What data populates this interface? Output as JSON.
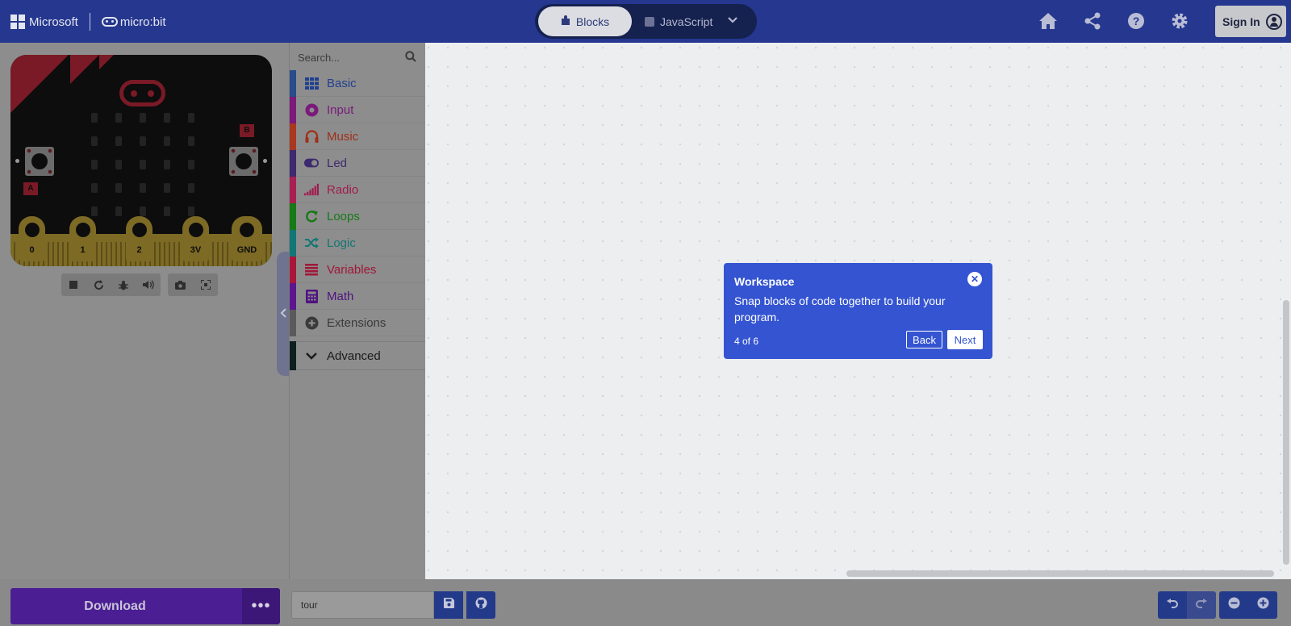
{
  "header": {
    "brand_microsoft": "Microsoft",
    "brand_microbit": "micro:bit",
    "mode_blocks": "Blocks",
    "mode_javascript": "JavaScript",
    "signin_label": "Sign In",
    "icons": [
      "home-icon",
      "share-icon",
      "help-icon",
      "settings-icon"
    ]
  },
  "simulator": {
    "button_a": "A",
    "button_b": "B",
    "pins": [
      "0",
      "1",
      "2",
      "3V",
      "GND"
    ],
    "tools": [
      "stop-icon",
      "restart-icon",
      "debug-icon",
      "mute-icon",
      "screenshot-icon",
      "fullscreen-icon"
    ]
  },
  "toolbox": {
    "search_placeholder": "Search...",
    "categories": [
      {
        "label": "Basic",
        "color": "#3a5a9e"
      },
      {
        "label": "Input",
        "color": "#8f1f8f"
      },
      {
        "label": "Music",
        "color": "#a8381f"
      },
      {
        "label": "Led",
        "color": "#3d2a6e"
      },
      {
        "label": "Radio",
        "color": "#a81f52"
      },
      {
        "label": "Loops",
        "color": "#167a16"
      },
      {
        "label": "Logic",
        "color": "#137676"
      },
      {
        "label": "Variables",
        "color": "#a8163a"
      },
      {
        "label": "Math",
        "color": "#5a158f"
      },
      {
        "label": "Extensions",
        "color": "#3a3a3a"
      }
    ],
    "advanced_label": "Advanced"
  },
  "tour": {
    "title": "Workspace",
    "body": "Snap blocks of code together to build your program.",
    "step": "4 of 6",
    "back_label": "Back",
    "next_label": "Next"
  },
  "bottombar": {
    "download_label": "Download",
    "more_label": "•••",
    "project_name": "tour"
  },
  "colors": {
    "header": "#25378f",
    "tour": "#3454d1",
    "download": "#4b1f93"
  }
}
